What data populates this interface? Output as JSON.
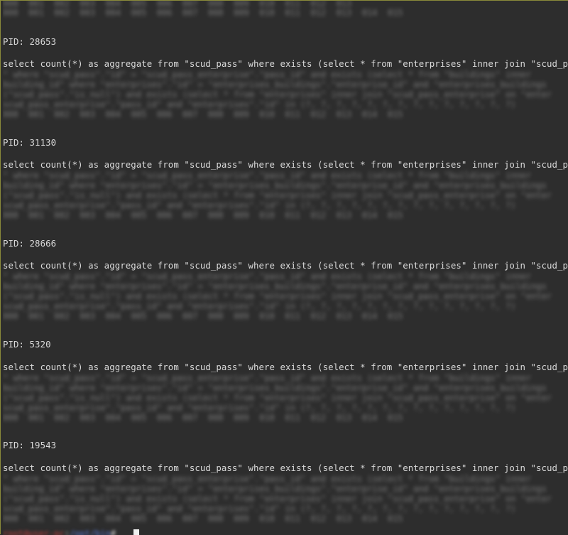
{
  "terminal": {
    "top_residual": "000  001  002  003  004  005  006  007  008  009  010  011  012  013",
    "entries": [
      {
        "pid": "PID: 28653",
        "query": "select count(*) as aggregate from \"scud_pass\" where exists (select * from \"enterprises\" inner join \"scud_p"
      },
      {
        "pid": "PID: 31130",
        "query": "select count(*) as aggregate from \"scud_pass\" where exists (select * from \"enterprises\" inner join \"scud_p"
      },
      {
        "pid": "PID: 28666",
        "query": "select count(*) as aggregate from \"scud_pass\" where exists (select * from \"enterprises\" inner join \"scud_p"
      },
      {
        "pid": "PID: 5320",
        "query": "select count(*) as aggregate from \"scud_pass\" where exists (select * from \"enterprises\" inner join \"scud_p"
      },
      {
        "pid": "PID: 19543",
        "query": "select count(*) as aggregate from \"scud_pass\" where exists (select * from \"enterprises\" inner join \"scud_p"
      }
    ],
    "blurred_lines": [
      "\" where \"scud_pass\".\"id\" = \"scud_pass_enterprise\".\"pass_id\" and exists (select * from \"buildings\" inner",
      "building_id\" where \"enterprises\".\"id\" = \"enterprises_buildings\".\"enterprise_id\" and \"enterprises_buildings",
      "(\"scud_pass\".\"is_null\") and exists (select * from \"enterprises\" inner join \"scud_pass_enterprise\" on \"enter",
      "scud_pass_enterprise\".\"pass_id\" and \"enterprises\".\"id\" in (?, ?, ?, ?, ?, ?, ?, ?, ?, ?, ?, ?, ?, ?)",
      "000  001  002  003  004  005  006  007  008  009  010  011  012  013  014  015"
    ],
    "prompt": {
      "user": "root@user-pc",
      "sep": ":",
      "path": "/opt/bin",
      "symbol": "#"
    }
  }
}
